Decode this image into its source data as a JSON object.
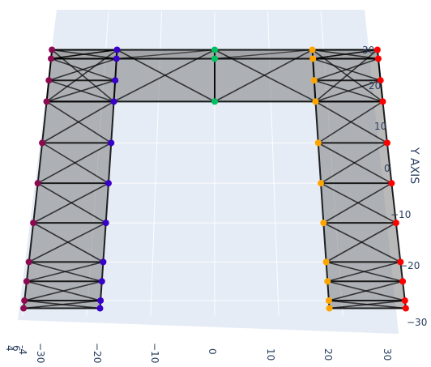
{
  "chart_data": {
    "type": "3d-mesh-wireframe",
    "title": "",
    "axes": {
      "x": {
        "label": "",
        "ticks": [
          "−30",
          "−20",
          "−10",
          "0",
          "10",
          "20",
          "30"
        ]
      },
      "y": {
        "label": "Y AXIS",
        "ticks": [
          "30",
          "20",
          "10",
          "0",
          "−10",
          "−20",
          "−30"
        ]
      },
      "z": {
        "label": "",
        "ticks": [
          "4",
          "6",
          "-4"
        ]
      }
    },
    "grid": true,
    "background": "#e5ecf6",
    "mesh_color": "#808080",
    "edge_color": "#000000",
    "series": [
      {
        "colorhex": "#8b0a50",
        "points": [
          [
            -30,
            -32
          ],
          [
            -30,
            -30
          ],
          [
            -30,
            -25
          ],
          [
            -30,
            -20
          ],
          [
            -30,
            -10
          ],
          [
            -30,
            0
          ],
          [
            -30,
            10
          ],
          [
            -30,
            20
          ],
          [
            -30,
            25
          ],
          [
            -30,
            30
          ],
          [
            -30,
            32
          ]
        ]
      },
      {
        "colorhex": "#3800c8",
        "points": [
          [
            -18,
            -32
          ],
          [
            -18,
            -30
          ],
          [
            -18,
            -25
          ],
          [
            -18,
            -20
          ],
          [
            -18,
            -10
          ],
          [
            -18,
            0
          ],
          [
            -18,
            10
          ],
          [
            -18,
            20
          ],
          [
            -18,
            25
          ],
          [
            -18,
            30
          ],
          [
            -18,
            32
          ]
        ]
      },
      {
        "colorhex": "#00c060",
        "points": [
          [
            0,
            20
          ],
          [
            0,
            30
          ],
          [
            0,
            32
          ]
        ]
      },
      {
        "colorhex": "#ffa500",
        "points": [
          [
            18,
            -32
          ],
          [
            18,
            -30
          ],
          [
            18,
            -25
          ],
          [
            18,
            -20
          ],
          [
            18,
            -10
          ],
          [
            18,
            0
          ],
          [
            18,
            10
          ],
          [
            18,
            20
          ],
          [
            18,
            25
          ],
          [
            18,
            30
          ],
          [
            18,
            32
          ]
        ]
      },
      {
        "colorhex": "#ff0000",
        "points": [
          [
            30,
            -32
          ],
          [
            30,
            -30
          ],
          [
            30,
            -25
          ],
          [
            30,
            -20
          ],
          [
            30,
            -10
          ],
          [
            30,
            0
          ],
          [
            30,
            10
          ],
          [
            30,
            20
          ],
          [
            30,
            25
          ],
          [
            30,
            30
          ],
          [
            30,
            32
          ]
        ]
      }
    ]
  }
}
